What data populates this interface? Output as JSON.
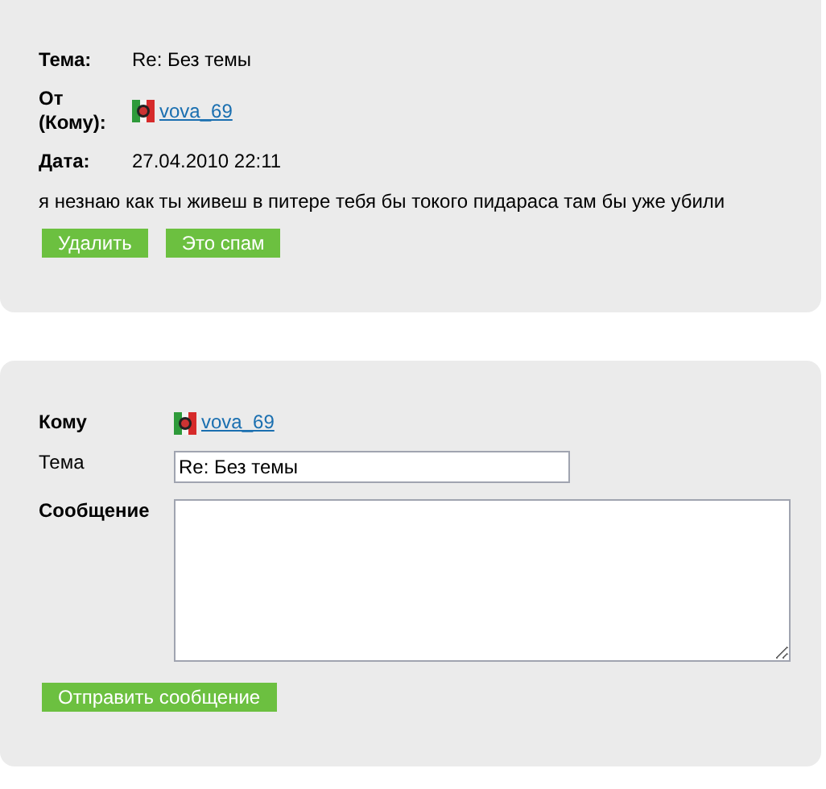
{
  "message": {
    "subject_label": "Тема:",
    "subject": "Re: Без темы",
    "from_label": "От (Кому):",
    "from_user": "vova_69",
    "date_label": "Дата:",
    "date": "27.04.2010 22:11",
    "body": "я незнаю как ты живеш в питере тебя бы токого пидараса там бы уже убили",
    "actions": [
      "Удалить",
      "Это спам"
    ]
  },
  "reply": {
    "to_label": "Кому",
    "to_user": "vova_69",
    "subject_label": "Тема",
    "subject_value": "Re: Без темы",
    "message_label": "Сообщение",
    "send_button": "Отправить сообщение"
  }
}
